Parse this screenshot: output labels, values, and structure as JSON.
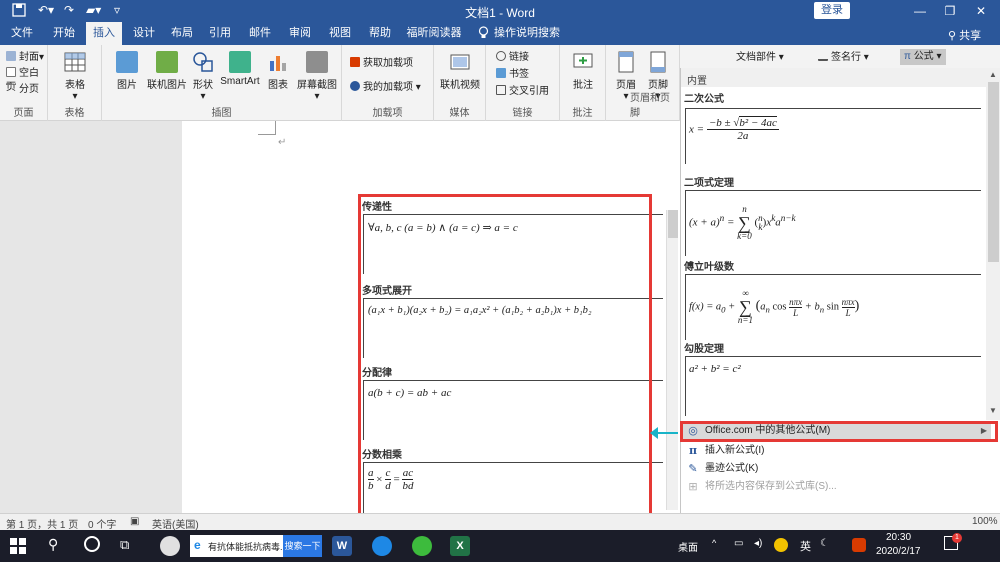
{
  "titlebar": {
    "doc_title": "文档1 - Word",
    "login": "登录"
  },
  "tabs": [
    "文件",
    "开始",
    "插入",
    "设计",
    "布局",
    "引用",
    "邮件",
    "审阅",
    "视图",
    "帮助",
    "福昕阅读器",
    "操作说明搜索"
  ],
  "share": "共享",
  "ribbon": {
    "pages": {
      "label": "页面",
      "cover": "封面",
      "blank": "空白页",
      "break": "分页"
    },
    "tables": {
      "label": "表格",
      "table": "表格"
    },
    "illustrations": {
      "label": "插图",
      "picture": "图片",
      "online_picture": "联机图片",
      "shapes": "形状",
      "smartart": "SmartArt",
      "chart": "图表",
      "screenshot": "屏幕截图"
    },
    "addins": {
      "label": "加载项",
      "get": "获取加载项",
      "my": "我的加载项"
    },
    "media": {
      "label": "媒体",
      "online_video": "联机视频"
    },
    "links": {
      "label": "链接",
      "link": "链接",
      "bookmark": "书签",
      "cross_ref": "交叉引用"
    },
    "comments": {
      "label": "批注",
      "comment": "批注"
    },
    "header_footer": {
      "label": "页眉和页脚",
      "header": "页眉",
      "footer": "页脚"
    },
    "text": {
      "doc_parts": "文档部件",
      "signature": "签名行"
    },
    "symbols": {
      "equation": "公式"
    }
  },
  "gallery_left": {
    "items": [
      {
        "title": "传递性",
        "eq": "∀a, b, c (a = b) ∧ (a = c) ⇒ a = c"
      },
      {
        "title": "多项式展开",
        "eq": "(a₁x + b₁)(a₂x + b₂) = a₁a₂x² + (a₁b₂ + a₂b₁)x + b₁b₂"
      },
      {
        "title": "分配律",
        "eq": "a(b + c) = ab + ac"
      },
      {
        "title": "分数相乘",
        "eq_a": "a",
        "eq_b": "b",
        "eq_c": "c",
        "eq_d": "d",
        "eq_ac": "ac",
        "eq_bd": "bd"
      }
    ]
  },
  "dropdown": {
    "header": "内置",
    "items": [
      {
        "title": "二次公式"
      },
      {
        "title": "二项式定理"
      },
      {
        "title": "傅立叶级数"
      },
      {
        "title": "勾股定理",
        "eq": "a² + b² = c²"
      }
    ],
    "menu": {
      "office": "Office.com 中的其他公式(M)",
      "insert": "插入新公式(I)",
      "ink": "墨迹公式(K)",
      "save": "将所选内容保存到公式库(S)..."
    }
  },
  "statusbar": {
    "page": "第 1 页，共 1 页",
    "words": "0 个字",
    "lang": "英语(美国)",
    "zoom": "100%"
  },
  "taskbar": {
    "browser_tab": "有抗体能抵抗病毒...",
    "search_btn": "搜索一下",
    "desktop": "桌面",
    "ime": "英",
    "time": "20:30",
    "date": "2020/2/17",
    "badge": "1"
  },
  "colors": {
    "word_blue": "#2b579a",
    "highlight_red": "#e53935",
    "arrow": "#19b4c8"
  }
}
